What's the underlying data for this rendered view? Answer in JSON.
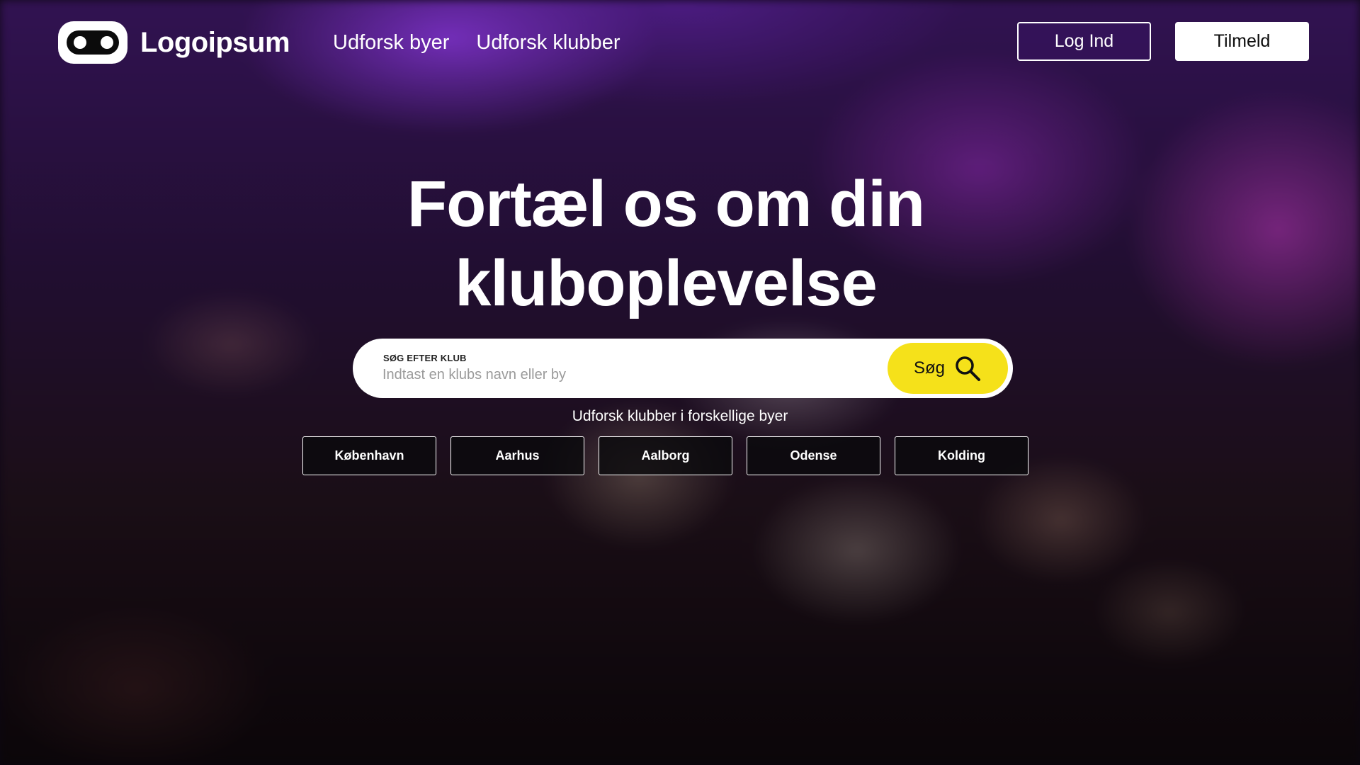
{
  "header": {
    "logo_text": "Logoipsum",
    "nav": [
      {
        "label": "Udforsk byer"
      },
      {
        "label": "Udforsk klubber"
      }
    ],
    "login_label": "Log Ind",
    "signup_label": "Tilmeld"
  },
  "hero": {
    "headline_line1": "Fortæl os om din",
    "headline_line2": "kluboplevelse"
  },
  "search": {
    "label": "SØG EFTER KLUB",
    "placeholder": "Indtast en klubs navn eller by",
    "value": "",
    "button_label": "Søg",
    "button_icon": "search-icon"
  },
  "cities": {
    "heading": "Udforsk klubber i forskellige byer",
    "items": [
      {
        "label": "København"
      },
      {
        "label": "Aarhus"
      },
      {
        "label": "Aalborg"
      },
      {
        "label": "Odense"
      },
      {
        "label": "Kolding"
      }
    ]
  },
  "colors": {
    "accent": "#f5e11a",
    "text": "#ffffff",
    "button_dark": "#0a0a0c"
  }
}
